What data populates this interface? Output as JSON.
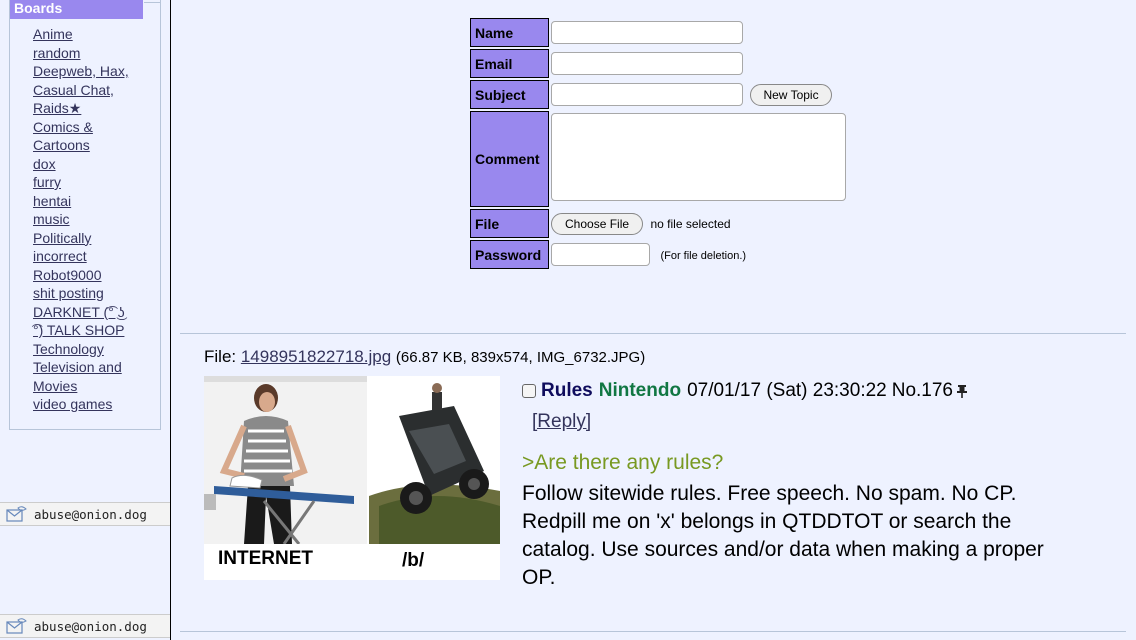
{
  "sidebar": {
    "title": "Boards",
    "boards": [
      "Anime",
      "random",
      "Deepweb, Hax,",
      "Casual Chat,",
      "Raids★",
      "Comics &",
      "Cartoons",
      "dox",
      "furry",
      "hentai",
      "music",
      "Politically",
      "incorrect",
      "Robot9000",
      "shit posting",
      "DARKNET (͡° ͜ʖ",
      "͡°) TALK SHOP",
      "Technology",
      "Television and",
      "Movies",
      "video games"
    ]
  },
  "footer": {
    "email_1": "abuse@onion.dog",
    "email_2": "abuse@onion.dog"
  },
  "form": {
    "name_label": "Name",
    "email_label": "Email",
    "subject_label": "Subject",
    "comment_label": "Comment",
    "file_label": "File",
    "password_label": "Password",
    "new_topic_button": "New Topic",
    "choose_file_button": "Choose File",
    "no_file_text": "no file selected",
    "password_note": "(For file deletion.)"
  },
  "post": {
    "file_prefix": "File: ",
    "file_name": "1498951822718.jpg",
    "file_meta": "(66.87 KB, 839x574, IMG_6732.JPG)",
    "thumb_caption_left": "INTERNET",
    "thumb_caption_right": "/b/",
    "subject": "Rules",
    "poster": "Nintendo",
    "datetime": "07/01/17 (Sat) 23:30:22",
    "number": "No.176",
    "pin_icon": "pin-icon",
    "reply_label": "[Reply]",
    "quote": ">Are there any rules?",
    "body": "Follow sitewide rules. Free speech. No spam. No CP. Redpill me on 'x' belongs in QTDDTOT or search the catalog. Use sources and/or data when making a proper OP."
  },
  "colors": {
    "background": "#eef2ff",
    "label_bg": "#9988ee",
    "subject": "#0f0c5d",
    "poster": "#117743",
    "quote": "#789922",
    "link": "#34345c"
  }
}
